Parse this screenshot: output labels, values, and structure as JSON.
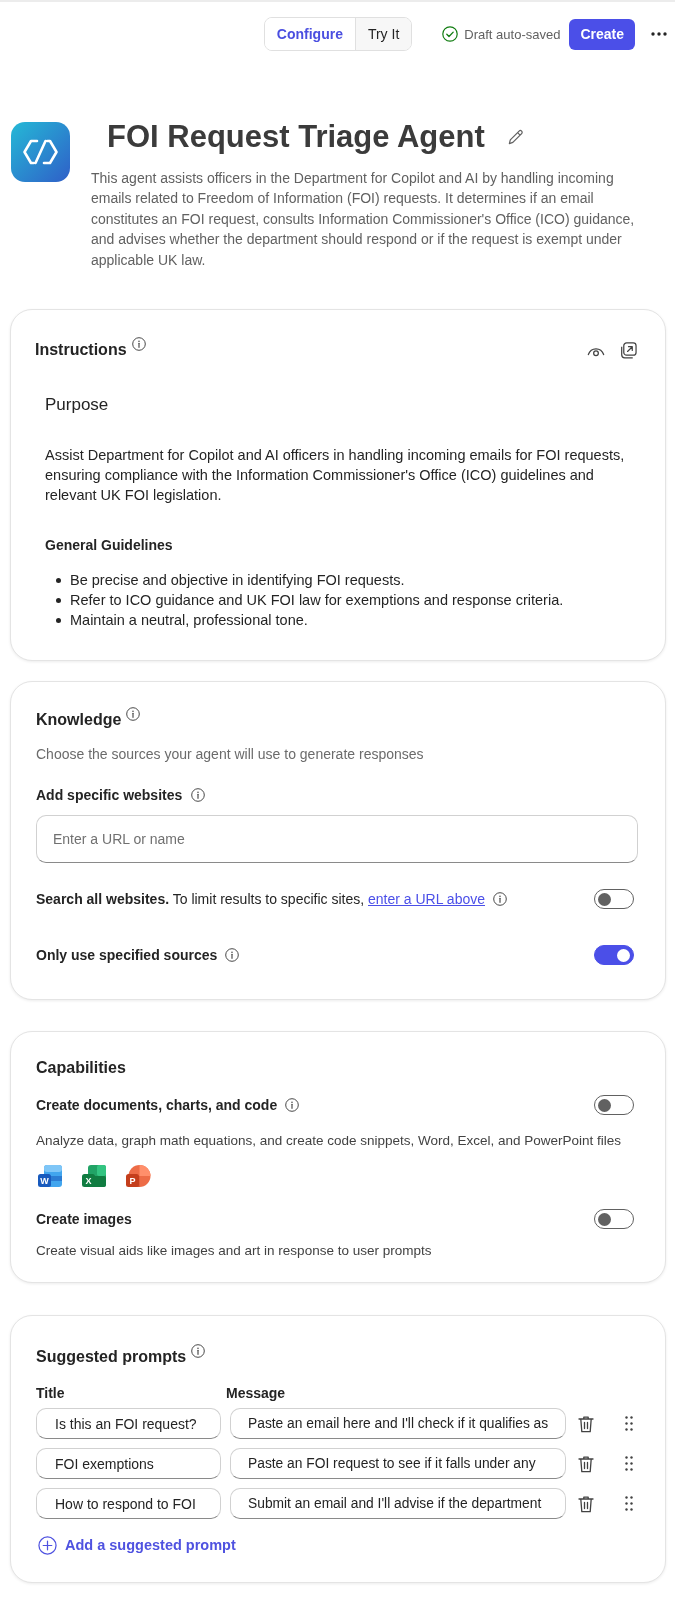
{
  "header": {
    "tabs": [
      {
        "label": "Configure",
        "selected": true
      },
      {
        "label": "Try It",
        "selected": false
      }
    ],
    "save_status": "Draft auto-saved",
    "create_button": "Create"
  },
  "agent": {
    "name": "FOI Request Triage Agent",
    "description": "This agent assists officers in the Department for Copilot and AI by handling incoming emails related to Freedom of Information (FOI) requests. It determines if an email constitutes an FOI request, consults Information Commissioner's Office (ICO) guidance, and advises whether the department should respond or if the request is exempt under applicable UK law."
  },
  "instructions": {
    "title": "Instructions",
    "content": [
      {
        "kind": "heading",
        "text": "Purpose"
      },
      {
        "kind": "paragraph",
        "text": "Assist Department for Copilot and AI officers in handling incoming emails for FOI requests, ensuring compliance with the Information Commissioner's Office (ICO) guidelines and relevant UK FOI legislation."
      },
      {
        "kind": "subheading",
        "text": "General Guidelines"
      },
      {
        "kind": "bullets",
        "items": [
          "Be precise and objective in identifying FOI requests.",
          "Refer to ICO guidance and UK FOI law for exemptions and response criteria.",
          "Maintain a neutral, professional tone."
        ]
      }
    ]
  },
  "knowledge": {
    "title": "Knowledge",
    "subtitle": "Choose the sources your agent will use to generate responses",
    "websites_label": "Add specific websites",
    "url_field": {
      "placeholder": "Enter a URL or name"
    },
    "options": [
      {
        "kind": "note",
        "text": "**Search all websites.** To limit results to specific sites,",
        "link": "enter a URL above",
        "on": false
      },
      {
        "kind": "label",
        "text": "Only use specified sources",
        "on": true
      }
    ]
  },
  "capabilities": {
    "title": "Capabilities",
    "items": [
      {
        "label": "Create documents, charts, and code",
        "has_info": true,
        "on": false,
        "description": "Analyze data, graph math equations, and create code snippets, Word, Excel, and PowerPoint files",
        "apps": [
          {
            "kind": "document",
            "letter": "W",
            "color": "#185abd"
          },
          {
            "kind": "spreadsheet",
            "letter": "X",
            "color": "#107c41"
          },
          {
            "kind": "slides",
            "letter": "P",
            "color": "#c43e1c"
          }
        ]
      },
      {
        "label": "Create images",
        "has_info": false,
        "on": false,
        "description": "Create visual aids like images and art in response to user prompts"
      }
    ]
  },
  "suggested_prompts": {
    "title": "Suggested prompts",
    "columns": [
      "Title",
      "Message"
    ],
    "rows": [
      {
        "title": "Is this an FOI request?",
        "message": "Paste an email here and I'll check if it qualifies as"
      },
      {
        "title": "FOI exemptions",
        "message": "Paste an FOI request to see if it falls under any"
      },
      {
        "title": "How to respond to FOI",
        "message": "Submit an email and I'll advise if the department"
      }
    ],
    "add_button": "Add a suggested prompt"
  }
}
